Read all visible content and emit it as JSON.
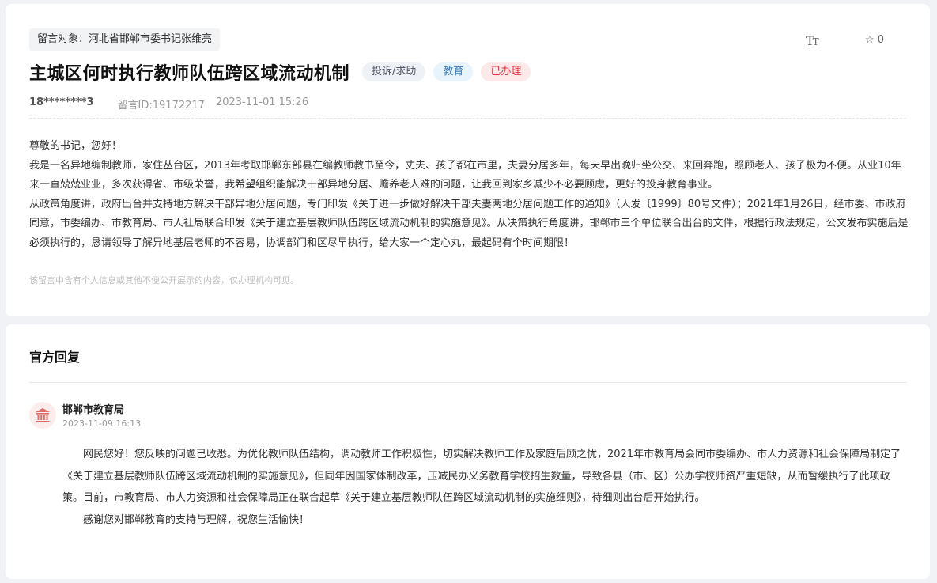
{
  "message": {
    "target": "留言对象：河北省邯郸市委书记张维亮",
    "font_size_glyph_big": "T",
    "font_size_glyph_small": "T",
    "favorite_count": "0",
    "title": "主城区何时执行教师队伍跨区域流动机制",
    "tags": {
      "type": "投诉/求助",
      "category": "教育",
      "status": "已办理"
    },
    "user": "18********3",
    "message_id": "留言ID:19172217",
    "timestamp": "2023-11-01 15:26",
    "paragraphs": [
      "尊敬的书记，您好！",
      "我是一名异地编制教师，家住丛台区，2013年考取邯郸东部县在编教师教书至今，丈夫、孩子都在市里，夫妻分居多年，每天早出晚归坐公交、来回奔跑，照顾老人、孩子极为不便。从业10年来一直兢兢业业，多次获得省、市级荣誉，我希望组织能解决干部异地分居、赡养老人难的问题，让我回到家乡减少不必要顾虑，更好的投身教育事业。",
      "从政策角度讲，政府出台并支持地方解决干部异地分居问题，专门印发《关于进一步做好解决干部夫妻两地分居问题工作的通知》（人发〔1999〕80号文件）；2021年1月26日，经市委、市政府同意，市委编办、市教育局、市人社局联合印发《关于建立基层教师队伍跨区域流动机制的实施意见》。从决策执行角度讲，邯郸市三个单位联合出台的文件，根据行政法规定，公文发布实施后是必须执行的，恳请领导了解异地基层老师的不容易，协调部门和区尽早执行，给大家一个定心丸，最起码有个时间期限！"
    ],
    "privacy_notice": "该留言中含有个人信息或其他不便公开展示的内容，仅办理机构可见。"
  },
  "reply": {
    "heading": "官方回复",
    "org_name": "邯郸市教育局",
    "timestamp": "2023-11-09 16:13",
    "paragraphs": [
      "网民您好！您反映的问题已收悉。为优化教师队伍结构，调动教师工作积极性，切实解决教师工作及家庭后顾之忧，2021年市教育局会同市委编办、市人力资源和社会保障局制定了《关于建立基层教师队伍跨区域流动机制的实施意见》，但同年因国家体制改革，压减民办义务教育学校招生数量，导致各县（市、区）公办学校师资严重短缺，从而暂缓执行了此项政策。目前，市教育局、市人力资源和社会保障局正在联合起草《关于建立基层教师队伍跨区域流动机制的实施细则》，待细则出台后开始执行。",
      "感谢您对邯郸教育的支持与理解，祝您生活愉快！"
    ]
  },
  "icons": {
    "font_size": "font-size-icon",
    "favorite": "star-outline-icon",
    "org_avatar": "government-building-icon"
  },
  "colors": {
    "status_red": "#d9363e",
    "category_blue": "#3a7bb8",
    "avatar_red": "#e06b6b"
  }
}
